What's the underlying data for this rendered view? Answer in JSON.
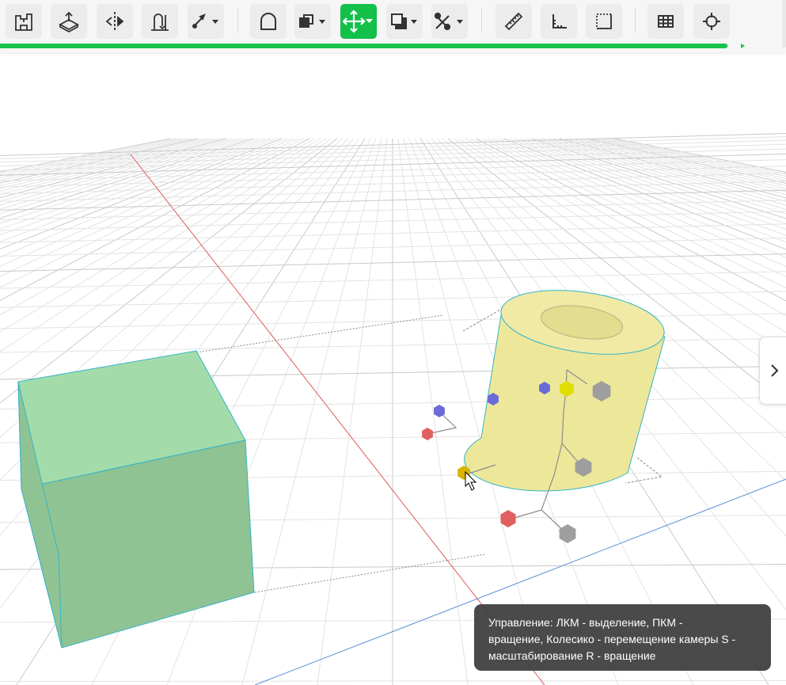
{
  "toolbar": {
    "buttons": [
      {
        "icon": "building-icon",
        "active": false
      },
      {
        "icon": "extrude-plane-icon",
        "active": false
      },
      {
        "icon": "mirror-icon",
        "active": false
      },
      {
        "icon": "sweep-icon",
        "active": false
      },
      {
        "icon": "brush-dropdown-icon",
        "active": false
      },
      {
        "icon": "fillet-icon",
        "active": false
      },
      {
        "icon": "boolean-dropdown-icon",
        "active": false
      },
      {
        "icon": "move-dropdown-icon",
        "active": true
      },
      {
        "icon": "copy-dropdown-icon",
        "active": false
      },
      {
        "icon": "tools-dropdown-icon",
        "active": false
      },
      {
        "icon": "ruler-icon",
        "active": false
      },
      {
        "icon": "corner-angle-icon",
        "active": false
      },
      {
        "icon": "frame-icon",
        "active": false
      },
      {
        "icon": "grid-table-icon",
        "active": false
      },
      {
        "icon": "crosshair-icon",
        "active": false
      }
    ],
    "progress_percent": 92.5
  },
  "viewport": {
    "colors": {
      "cube": "#99d6a0",
      "cylinder": "#ede79a",
      "x_axis": "#e05a5a",
      "y_axis": "#5a8fd6",
      "handle_red": "#e06060",
      "handle_blue": "#6a6ad8",
      "handle_yellow": "#dede00",
      "handle_gray": "#9e9e9e"
    },
    "side_toggle_icon": "chevron-right-icon"
  },
  "tooltip": {
    "line1": "Управление: ЛКМ - выделение, ПКМ -",
    "line2": "вращение, Колесико - перемещение камеры S -",
    "line3": "масштабирование R - вращение"
  }
}
